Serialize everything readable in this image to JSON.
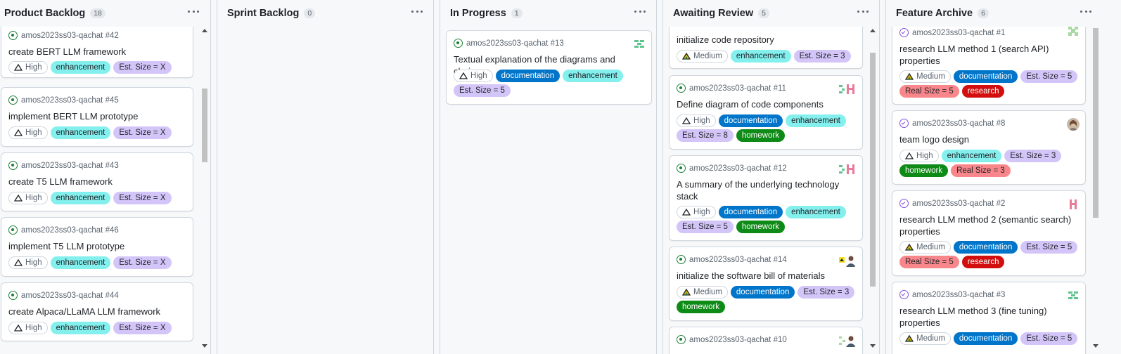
{
  "repo": "amos2023ss03-qachat",
  "columns": [
    {
      "title": "Product Backlog",
      "count": "18",
      "cards": [
        {
          "number": "#42",
          "title": "create BERT LLM framework",
          "labels": [
            {
              "kind": "priority",
              "text": "High"
            },
            {
              "kind": "enhancement",
              "text": "enhancement"
            },
            {
              "kind": "size",
              "text": "Est. Size = X"
            }
          ]
        },
        {
          "number": "#45",
          "title": "implement BERT LLM prototype",
          "labels": [
            {
              "kind": "priority",
              "text": "High"
            },
            {
              "kind": "enhancement",
              "text": "enhancement"
            },
            {
              "kind": "size",
              "text": "Est. Size = X"
            }
          ]
        },
        {
          "number": "#43",
          "title": "create T5 LLM framework",
          "labels": [
            {
              "kind": "priority",
              "text": "High"
            },
            {
              "kind": "enhancement",
              "text": "enhancement"
            },
            {
              "kind": "size",
              "text": "Est. Size = X"
            }
          ]
        },
        {
          "number": "#46",
          "title": "implement T5 LLM prototype",
          "labels": [
            {
              "kind": "priority",
              "text": "High"
            },
            {
              "kind": "enhancement",
              "text": "enhancement"
            },
            {
              "kind": "size",
              "text": "Est. Size = X"
            }
          ]
        },
        {
          "number": "#44",
          "title": "create Alpaca/LLaMA LLM framework",
          "labels": [
            {
              "kind": "priority",
              "text": "High"
            },
            {
              "kind": "enhancement",
              "text": "enhancement"
            },
            {
              "kind": "size",
              "text": "Est. Size = X"
            }
          ]
        }
      ]
    },
    {
      "title": "Sprint Backlog",
      "count": "0",
      "cards": []
    },
    {
      "title": "In Progress",
      "count": "1",
      "cards": [
        {
          "number": "#13",
          "title": "Textual explanation of the diagrams and choices",
          "labels": [
            {
              "kind": "priority",
              "text": "High"
            },
            {
              "kind": "documentation",
              "text": "documentation"
            },
            {
              "kind": "enhancement",
              "text": "enhancement"
            },
            {
              "kind": "size",
              "text": "Est. Size = 5"
            }
          ]
        }
      ]
    },
    {
      "title": "Awaiting Review",
      "count": "5",
      "cards": [
        {
          "number": "",
          "title": "initialize code repository",
          "labels": [
            {
              "kind": "priority-medium",
              "text": "Medium"
            },
            {
              "kind": "enhancement",
              "text": "enhancement"
            },
            {
              "kind": "size",
              "text": "Est. Size = 3"
            }
          ]
        },
        {
          "number": "#11",
          "title": "Define diagram of code components",
          "labels": [
            {
              "kind": "priority",
              "text": "High"
            },
            {
              "kind": "documentation",
              "text": "documentation"
            },
            {
              "kind": "enhancement",
              "text": "enhancement"
            },
            {
              "kind": "size",
              "text": "Est. Size = 8"
            },
            {
              "kind": "homework",
              "text": "homework"
            }
          ]
        },
        {
          "number": "#12",
          "title": "A summary of the underlying technology stack",
          "labels": [
            {
              "kind": "priority",
              "text": "High"
            },
            {
              "kind": "documentation",
              "text": "documentation"
            },
            {
              "kind": "enhancement",
              "text": "enhancement"
            },
            {
              "kind": "size",
              "text": "Est. Size = 5"
            },
            {
              "kind": "homework",
              "text": "homework"
            }
          ]
        },
        {
          "number": "#14",
          "title": "initialize the software bill of materials",
          "labels": [
            {
              "kind": "priority-medium",
              "text": "Medium"
            },
            {
              "kind": "documentation",
              "text": "documentation"
            },
            {
              "kind": "size",
              "text": "Est. Size = 3"
            },
            {
              "kind": "homework",
              "text": "homework"
            }
          ]
        },
        {
          "number": "#10",
          "title": "",
          "labels": []
        }
      ]
    },
    {
      "title": "Feature Archive",
      "count": "6",
      "cards": [
        {
          "number": "#1",
          "title": "research LLM method 1 (search API) properties",
          "labels": [
            {
              "kind": "priority-medium",
              "text": "Medium"
            },
            {
              "kind": "documentation",
              "text": "documentation"
            },
            {
              "kind": "size",
              "text": "Est. Size = 5"
            },
            {
              "kind": "realsize",
              "text": "Real Size = 5"
            },
            {
              "kind": "research",
              "text": "research"
            }
          ]
        },
        {
          "number": "#8",
          "title": "team logo design",
          "labels": [
            {
              "kind": "priority",
              "text": "High"
            },
            {
              "kind": "enhancement",
              "text": "enhancement"
            },
            {
              "kind": "size",
              "text": "Est. Size = 3"
            },
            {
              "kind": "homework",
              "text": "homework"
            },
            {
              "kind": "realsize",
              "text": "Real Size = 3"
            }
          ]
        },
        {
          "number": "#2",
          "title": "research LLM method 2 (semantic search) properties",
          "labels": [
            {
              "kind": "priority-medium",
              "text": "Medium"
            },
            {
              "kind": "documentation",
              "text": "documentation"
            },
            {
              "kind": "size",
              "text": "Est. Size = 5"
            },
            {
              "kind": "realsize",
              "text": "Real Size = 5"
            },
            {
              "kind": "research",
              "text": "research"
            }
          ]
        },
        {
          "number": "#3",
          "title": "research LLM method 3 (fine tuning) properties",
          "labels": [
            {
              "kind": "priority-medium",
              "text": "Medium"
            },
            {
              "kind": "documentation",
              "text": "documentation"
            },
            {
              "kind": "size",
              "text": "Est. Size = 5"
            }
          ]
        }
      ]
    }
  ],
  "colors": {
    "open_issue": "#1a7f37",
    "closed_issue": "#8250df",
    "enhancement": "#84f0ee",
    "documentation": "#0075ca",
    "estimate": "#d4c5f9",
    "homework": "#0e8a16",
    "real_size": "#f9868a",
    "research": "#d20e0e"
  },
  "icons": {
    "open": "issue-opened-icon",
    "closed": "issue-closed-icon",
    "menu": "kebab-horizontal-icon",
    "priority_high": "priority-high-icon",
    "priority_medium": "priority-medium-icon"
  }
}
